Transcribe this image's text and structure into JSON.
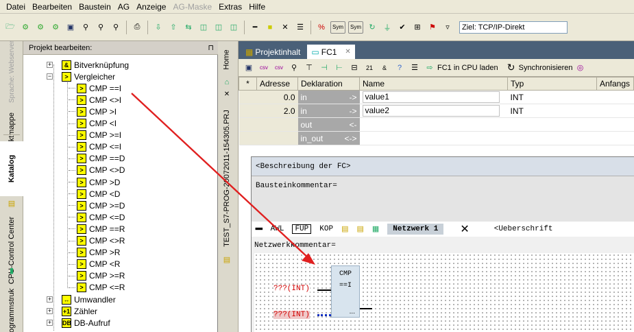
{
  "menu": [
    "Datei",
    "Bearbeiten",
    "Baustein",
    "AG",
    "Anzeige",
    "AG-Maske",
    "Extras",
    "Hilfe"
  ],
  "menu_disabled_index": 5,
  "toolbar": {
    "target_label": "Ziel: TCP/IP-Direkt",
    "sym1": "Sym",
    "sym2": "Sym"
  },
  "left_tabs": [
    "Projektmappe",
    "Katalog",
    "CPU-Control Center",
    "Programmstruktur"
  ],
  "left_tabs_top": "Sprache: Webserver",
  "project": {
    "header": "Projekt bearbeiten:",
    "pin": "⊓",
    "tree_top": [
      {
        "icon": "&",
        "label": "Bitverknüpfung",
        "exp": "+"
      },
      {
        "icon": ">",
        "label": "Vergleicher",
        "exp": "−"
      }
    ],
    "compare_items": [
      "CMP ==I",
      "CMP <>I",
      "CMP >I",
      "CMP <I",
      "CMP >=I",
      "CMP <=I",
      "CMP ==D",
      "CMP <>D",
      "CMP >D",
      "CMP <D",
      "CMP >=D",
      "CMP <=D",
      "CMP ==R",
      "CMP <>R",
      "CMP >R",
      "CMP <R",
      "CMP >=R",
      "CMP <=R"
    ],
    "tree_bottom": [
      {
        "icon": "↔",
        "label": "Umwandler",
        "exp": "+"
      },
      {
        "icon": "+1",
        "label": "Zähler",
        "exp": "+"
      },
      {
        "icon": "DB",
        "label": "DB-Aufruf",
        "exp": "+"
      }
    ]
  },
  "mid_tabs": [
    "Home",
    "TEST_S7-PROG-20072011-154305.PRJ"
  ],
  "editor": {
    "tabs": [
      "Projektinhalt",
      "FC1"
    ],
    "tab_close": "✕",
    "toolbar_load": "FC1 in CPU laden",
    "toolbar_sync": "Synchronisieren",
    "columns": [
      "*",
      "Adresse",
      "Deklaration",
      "Name",
      "Typ",
      "Anfangs"
    ],
    "rows": [
      {
        "addr": "0.0",
        "decl": "in",
        "arrow": "->",
        "name": "value1",
        "type": "INT"
      },
      {
        "addr": "2.0",
        "decl": "in",
        "arrow": "->",
        "name": "value2",
        "type": "INT"
      },
      {
        "addr": "",
        "decl": "out",
        "arrow": "<-",
        "name": "",
        "type": ""
      },
      {
        "addr": "",
        "decl": "in_out",
        "arrow": "<->",
        "name": "",
        "type": ""
      }
    ]
  },
  "fc": {
    "description": "<Beschreibung der FC>",
    "comment": "Bausteinkommentar=",
    "net_tabs": [
      "AWL",
      "FUP",
      "KOP"
    ],
    "network": "Netzwerk 1",
    "heading": "<Ueberschrift",
    "net_comment": "Netzwerkkommentar=",
    "box_title": "CMP",
    "box_op": "==I",
    "in1": "???(INT)",
    "in2": "???(INT)",
    "out_dots": "..."
  }
}
